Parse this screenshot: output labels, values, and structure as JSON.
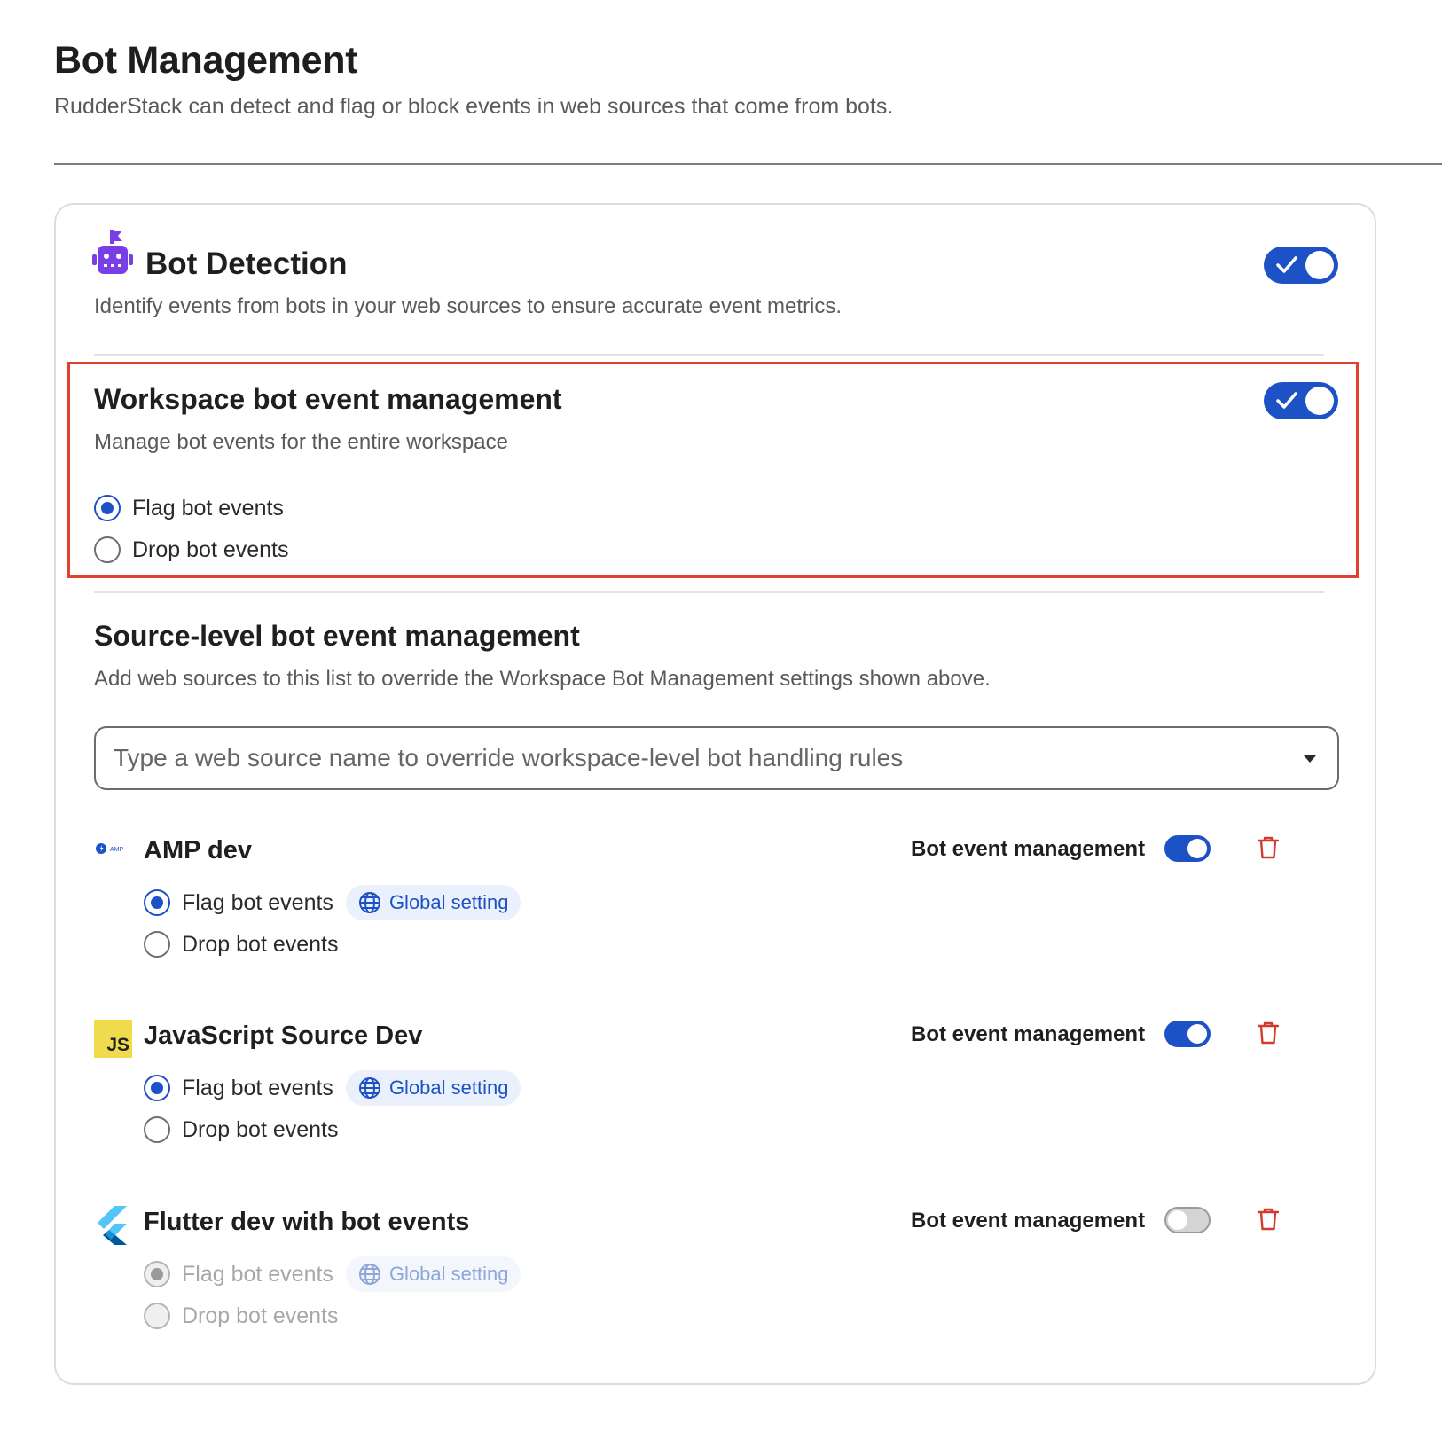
{
  "header": {
    "title": "Bot Management",
    "subtitle": "RudderStack can detect and flag or block events in web sources that come from bots."
  },
  "bot_detection": {
    "title": "Bot Detection",
    "description": "Identify events from bots in your web sources to ensure accurate event metrics.",
    "enabled": true,
    "icon": "robot-icon"
  },
  "workspace": {
    "title": "Workspace bot event management",
    "description": "Manage bot events for the entire workspace",
    "enabled": true,
    "options": [
      "Flag bot events",
      "Drop bot events"
    ],
    "selected": "Flag bot events"
  },
  "source_level": {
    "title": "Source-level bot event management",
    "description": "Add web sources to this list to override the Workspace Bot Management settings shown above.",
    "search_placeholder": "Type a web source name to override workspace-level bot handling rules"
  },
  "sources": [
    {
      "name": "AMP dev",
      "icon": "amp-icon",
      "toggle_label": "Bot event management",
      "enabled": true,
      "flag_label": "Flag bot events",
      "drop_label": "Drop bot events",
      "badge": "Global setting",
      "selected": "Flag bot events"
    },
    {
      "name": "JavaScript Source Dev",
      "icon": "javascript-icon",
      "icon_text": "JS",
      "toggle_label": "Bot event management",
      "enabled": true,
      "flag_label": "Flag bot events",
      "drop_label": "Drop bot events",
      "badge": "Global setting",
      "selected": "Flag bot events"
    },
    {
      "name": "Flutter dev with bot events",
      "icon": "flutter-icon",
      "toggle_label": "Bot event management",
      "enabled": false,
      "flag_label": "Flag bot events",
      "drop_label": "Drop bot events",
      "badge": "Global setting",
      "selected": "Flag bot events"
    }
  ],
  "colors": {
    "accent": "#1d52c6",
    "highlight": "#e0412c",
    "delete": "#d23a2c",
    "robot": "#7a3ee6"
  },
  "amp_icon_text": "AMP"
}
